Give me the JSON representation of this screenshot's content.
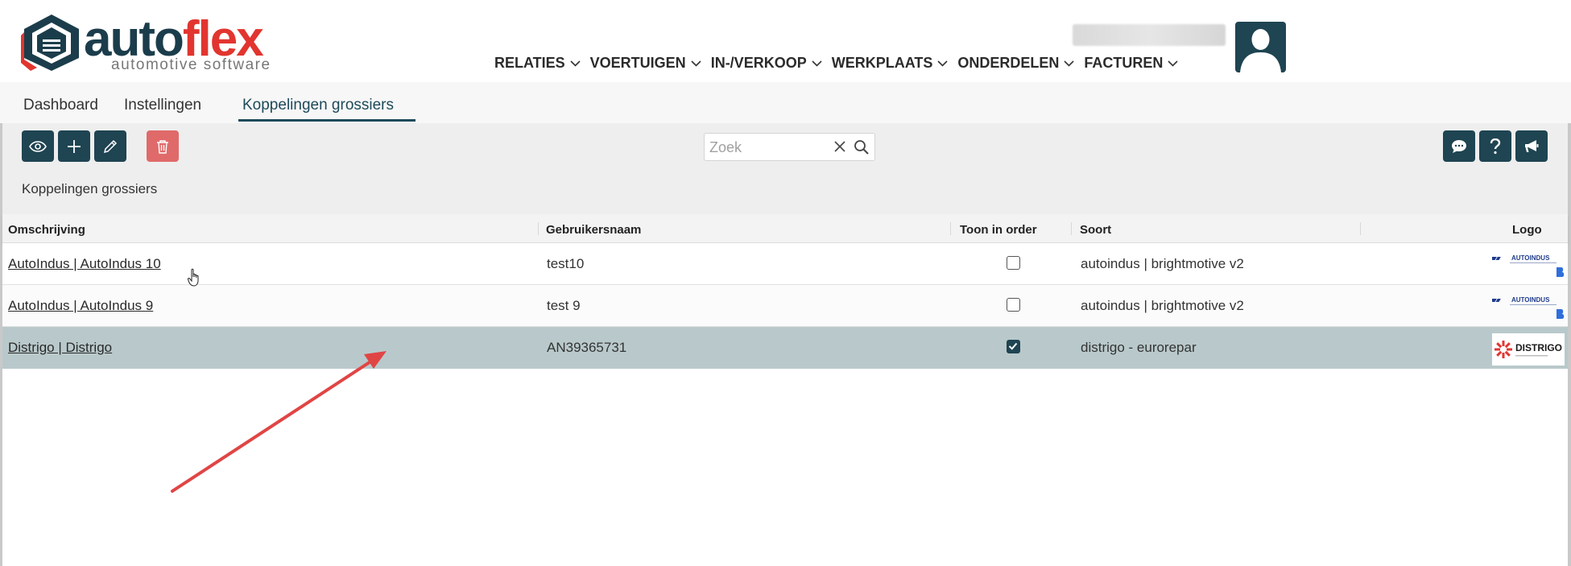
{
  "brand": {
    "name_part1": "auto",
    "name_part2": "flex",
    "tagline": "automotive software",
    "colors": {
      "dark": "#1b3d4b",
      "red": "#e2352f"
    }
  },
  "mainnav": [
    {
      "label": "RELATIES"
    },
    {
      "label": "VOERTUIGEN"
    },
    {
      "label": "IN-/VERKOOP"
    },
    {
      "label": "WERKPLAATS"
    },
    {
      "label": "ONDERDELEN"
    },
    {
      "label": "FACTUREN"
    }
  ],
  "tabs": [
    {
      "label": "Dashboard"
    },
    {
      "label": "Instellingen"
    },
    {
      "label": "Koppelingen grossiers",
      "active": true
    }
  ],
  "toolbar": {
    "icons": [
      "eye-icon",
      "plus-icon",
      "pencil-icon",
      "trash-icon",
      "chat-icon",
      "question-icon",
      "megaphone-icon"
    ]
  },
  "search": {
    "placeholder": "Zoek",
    "value": ""
  },
  "section": {
    "title": "Koppelingen grossiers"
  },
  "table": {
    "columns": [
      "Omschrijving",
      "Gebruikersnaam",
      "Toon in order",
      "Soort",
      "Logo"
    ],
    "rows": [
      {
        "omschrijving": "AutoIndus | AutoIndus 10",
        "gebruikersnaam": "test10",
        "toon_in_order": false,
        "soort": "autoindus | brightmotive v2",
        "logo": "AUTOINDUS"
      },
      {
        "omschrijving": "AutoIndus | AutoIndus 9",
        "gebruikersnaam": "test 9",
        "toon_in_order": false,
        "soort": "autoindus | brightmotive v2",
        "logo": "AUTOINDUS"
      },
      {
        "omschrijving": "Distrigo | Distrigo",
        "gebruikersnaam": "AN39365731",
        "toon_in_order": true,
        "soort": "distrigo - eurorepar",
        "logo": "DISTRIGO",
        "selected": true
      }
    ]
  },
  "theme": {
    "primary": "#1f4452",
    "danger": "#e06a6a",
    "selected_row": "#b9c9cb",
    "annotation_arrow": "#e04545"
  }
}
